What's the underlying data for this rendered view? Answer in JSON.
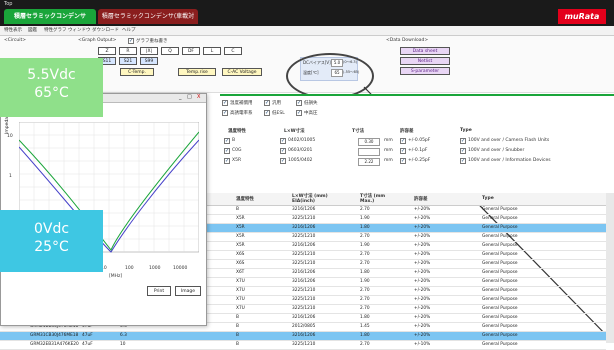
{
  "header": {
    "top_label": "Top",
    "tab_active": "積層セラミックコンデンサ",
    "tab_other": "積層セラミックコンデンサ(車載対応)",
    "logo": "muRata"
  },
  "menu": [
    "特性表示",
    "図鑑",
    "特性グラフ",
    "ウィンドウ",
    "ダウンロード",
    "ヘルプ"
  ],
  "toolbar": {
    "circuit_label": "<Circuit>",
    "graph_output_label": "<Graph Output>",
    "overlay_checkbox": "グラフ重ね書き",
    "graph_buttons": [
      "Z",
      "R",
      "|X|",
      "Q",
      "DF",
      "L",
      "C"
    ],
    "row2_buttons": [
      "S11",
      "S21",
      "S99"
    ],
    "row3_buttons": [
      "C-Temp.",
      "Temp.rise",
      "C-AC Voltage"
    ],
    "param_labels": [
      "DCバイアス[V]",
      "温度[℃]"
    ],
    "param_values": [
      "5.0",
      "65"
    ],
    "param_ranges": [
      "(0〜6.3)",
      "(-55〜85)"
    ],
    "data_download_label": "<Data Download>",
    "download_buttons": [
      "Data sheet",
      "Netlist",
      "S-parameter"
    ]
  },
  "filter": {
    "checks": [
      "温度補償用",
      "汎用",
      "低損失",
      "高誘電率系",
      "低ESL",
      "中高圧"
    ],
    "headers": [
      "温度特性",
      "L×W寸法",
      "T寸法",
      "許容差",
      "Type"
    ],
    "temp_options": [
      "B",
      "C0G",
      "X5R"
    ],
    "size_options": [
      "0402/01005",
      "0603/0201",
      "1005/0402"
    ],
    "t_values": [
      "0.30",
      "",
      "2.22"
    ],
    "t_units": [
      "mm",
      "mm",
      "mm"
    ],
    "tol_options": [
      "+/-0.05pF",
      "+/-0.1pF",
      "+/-0.25pF"
    ],
    "type_options": [
      "100V and over / Camera Flash Units",
      "100V and over / Snubber",
      "100V and over / Information Devices"
    ]
  },
  "table": {
    "headers": [
      "温度特性",
      "L×W寸法 (mm) EIA(inch)",
      "T寸法 (mm Max.)",
      "許容差",
      "Type"
    ],
    "rows": [
      {
        "part": "",
        "cap": "",
        "v": "",
        "temp": "B",
        "size": "3216/1206",
        "t": "2.70",
        "tol": "+/-20%",
        "type": "General Purpose",
        "hl": false
      },
      {
        "part": "",
        "cap": "",
        "v": "",
        "temp": "X5R",
        "size": "3225/1210",
        "t": "1.90",
        "tol": "+/-20%",
        "type": "General Purpose",
        "hl": false
      },
      {
        "part": "",
        "cap": "",
        "v": "",
        "temp": "X5R",
        "size": "3216/1206",
        "t": "1.80",
        "tol": "+/-20%",
        "type": "General Purpose",
        "hl": true
      },
      {
        "part": "",
        "cap": "",
        "v": "",
        "temp": "X5R",
        "size": "3225/1210",
        "t": "2.70",
        "tol": "+/-20%",
        "type": "General Purpose",
        "hl": false
      },
      {
        "part": "",
        "cap": "",
        "v": "",
        "temp": "X5R",
        "size": "3216/1206",
        "t": "1.90",
        "tol": "+/-20%",
        "type": "General Purpose",
        "hl": false
      },
      {
        "part": "",
        "cap": "",
        "v": "",
        "temp": "X6S",
        "size": "3225/1210",
        "t": "2.70",
        "tol": "+/-20%",
        "type": "General Purpose",
        "hl": false
      },
      {
        "part": "",
        "cap": "",
        "v": "",
        "temp": "X6S",
        "size": "3225/1210",
        "t": "2.70",
        "tol": "+/-20%",
        "type": "General Purpose",
        "hl": false
      },
      {
        "part": "",
        "cap": "",
        "v": "",
        "temp": "X6T",
        "size": "3216/1206",
        "t": "1.80",
        "tol": "+/-20%",
        "type": "General Purpose",
        "hl": false
      },
      {
        "part": "",
        "cap": "",
        "v": "",
        "temp": "X7U",
        "size": "3216/1206",
        "t": "1.90",
        "tol": "+/-20%",
        "type": "General Purpose",
        "hl": false
      },
      {
        "part": "GRM32ER61C476KE15",
        "cap": "100uF",
        "v": "4.0",
        "temp": "X7U",
        "size": "3225/1210",
        "t": "2.70",
        "tol": "+/-20%",
        "type": "General Purpose",
        "hl": false
      },
      {
        "part": "GRM32ER60J107ME20",
        "cap": "100uF",
        "v": "6.3",
        "temp": "X7U",
        "size": "3225/1210",
        "t": "2.70",
        "tol": "+/-20%",
        "type": "General Purpose",
        "hl": false
      },
      {
        "part": "GRM32ER71A476KE15",
        "cap": "47uF",
        "v": "10",
        "temp": "X7U",
        "size": "3225/1210",
        "t": "2.70",
        "tol": "+/-20%",
        "type": "General Purpose",
        "hl": false
      },
      {
        "part": "GRM31CB30J476ME18",
        "cap": "47uF",
        "v": "6.3",
        "temp": "B",
        "size": "3216/1206",
        "t": "1.80",
        "tol": "+/-20%",
        "type": "General Purpose",
        "hl": false
      },
      {
        "part": "GRM21BB30J476ME18",
        "cap": "47uF",
        "v": "6.3",
        "temp": "B",
        "size": "2012/0805",
        "t": "1.45",
        "tol": "+/-20%",
        "type": "General Purpose",
        "hl": false
      },
      {
        "part": "GRM31CB30J476ME18",
        "cap": "47uF",
        "v": "6.3",
        "temp": "B",
        "size": "3216/1206",
        "t": "1.80",
        "tol": "+/-20%",
        "type": "General Purpose",
        "hl": true
      },
      {
        "part": "GRM32EB31A476KE20",
        "cap": "47uF",
        "v": "10",
        "temp": "B",
        "size": "3225/1210",
        "t": "2.70",
        "tol": "+/-10%",
        "type": "General Purpose",
        "hl": false
      }
    ]
  },
  "chart": {
    "ylabel": "Impedance[ohm]",
    "y_ticks": [
      "10",
      "1",
      "0.1",
      "0.01"
    ],
    "x_ticks": [
      "10",
      "100",
      "1000",
      "10000"
    ],
    "xlabel": "[MHz]",
    "buttons": [
      "Print",
      "Image"
    ],
    "window_controls": [
      "_",
      "□",
      "X"
    ]
  },
  "callouts": {
    "top": [
      "5.5Vdc",
      "65°C"
    ],
    "bottom": [
      "0Vdc",
      "25°C"
    ]
  },
  "colors": {
    "green_tab": "#1aa53a",
    "red_tab": "#8a1e1e",
    "murata": "#e3001b",
    "highlight": "#7cc5f2",
    "callout_top": "#8fe08a",
    "callout_bottom": "#3ec7e3"
  }
}
